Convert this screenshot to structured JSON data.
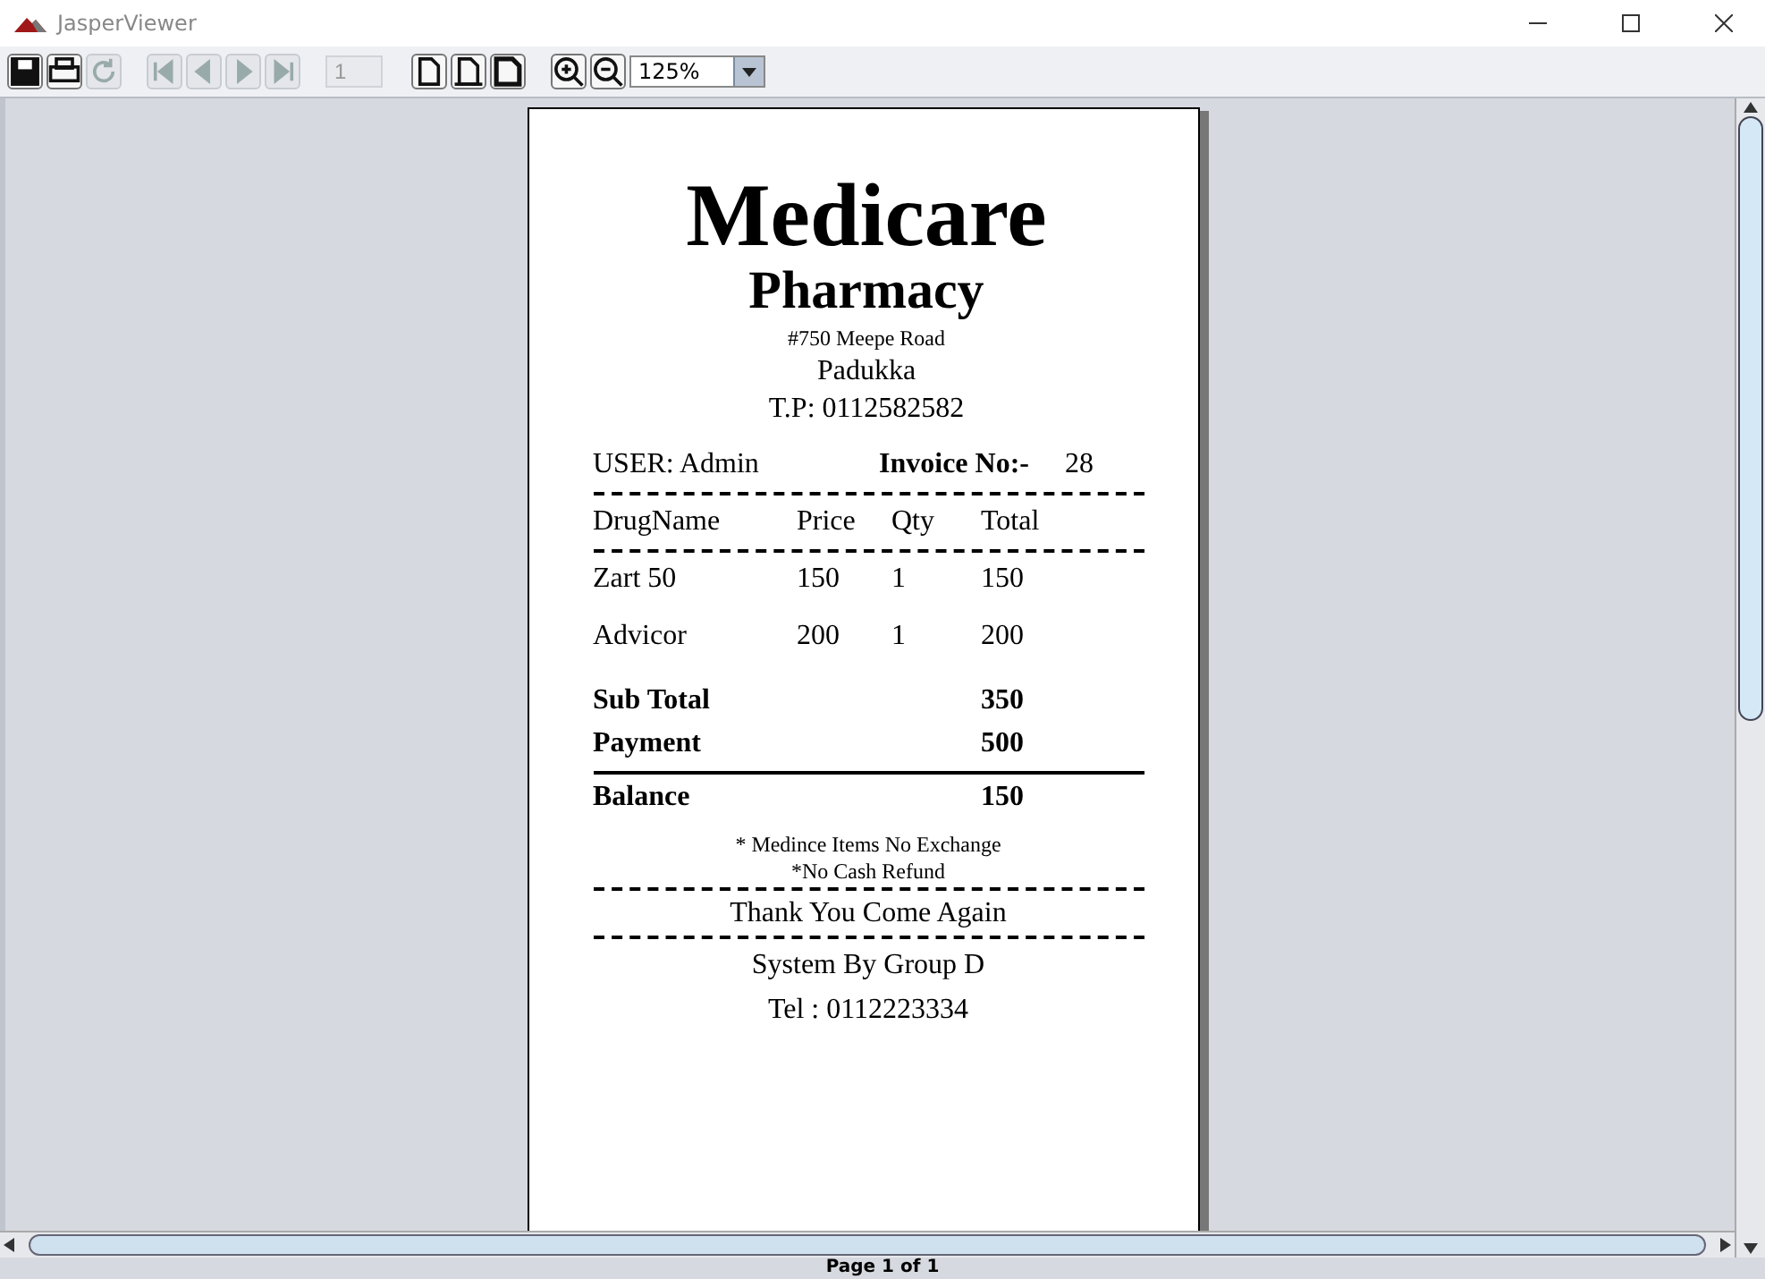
{
  "window": {
    "title": "JasperViewer"
  },
  "toolbar": {
    "buttons": [
      {
        "kind": "save",
        "disabled": false
      },
      {
        "kind": "print",
        "disabled": false
      },
      {
        "kind": "reload",
        "disabled": true
      },
      {
        "kind": "first",
        "disabled": true
      },
      {
        "kind": "previous",
        "disabled": true
      },
      {
        "kind": "next",
        "disabled": true
      },
      {
        "kind": "last",
        "disabled": true
      },
      {
        "kind": "page",
        "disabled": true,
        "value": "1"
      },
      {
        "kind": "actual-size",
        "disabled": false
      },
      {
        "kind": "fit-page",
        "disabled": false
      },
      {
        "kind": "fit-width",
        "disabled": false
      },
      {
        "kind": "zoom-in",
        "disabled": false
      },
      {
        "kind": "zoom-out",
        "disabled": false
      },
      {
        "kind": "zoom",
        "disabled": false,
        "value": "125%"
      }
    ]
  },
  "receipt": {
    "store_name": "Medicare",
    "store_subtitle": "Pharmacy",
    "address": "#750 Meepe Road",
    "city": "Padukka",
    "phone": "T.P: 0112582582",
    "user": "USER: Admin",
    "invoice_label": "Invoice No:-",
    "invoice_no": "28",
    "columns": [
      "DrugName",
      "Price",
      "Qty",
      "Total"
    ],
    "rows": [
      [
        "Zart 50",
        "150",
        "1",
        "150"
      ],
      [
        "Advicor",
        "200",
        "1",
        "200"
      ]
    ],
    "totals": [
      {
        "label": "Sub Total",
        "value": "350"
      },
      {
        "label": "Payment",
        "value": "500"
      }
    ],
    "balance": {
      "label": "Balance",
      "value": "150"
    },
    "notes": [
      "* Medince Items No Exchange",
      "*No Cash Refund"
    ],
    "thank_you": "Thank You Come Again",
    "footer": [
      "System By Group D",
      "Tel : 0112223334"
    ]
  },
  "status_bar": {
    "text": "Page 1 of 1"
  }
}
